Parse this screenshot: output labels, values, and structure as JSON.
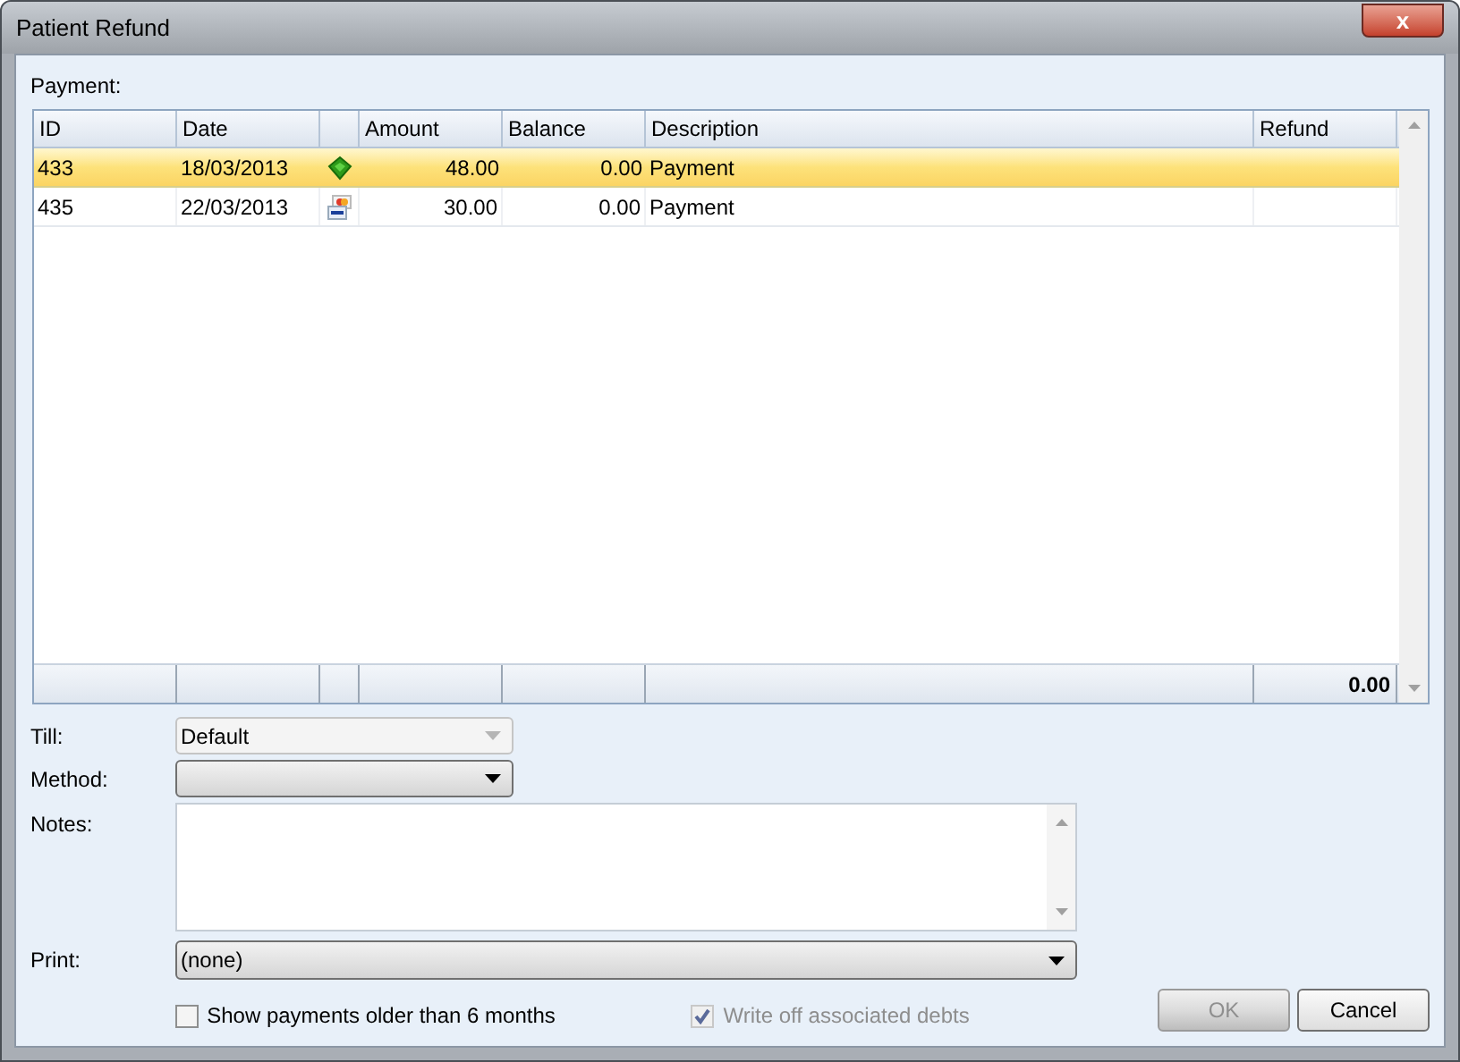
{
  "window": {
    "title": "Patient Refund",
    "close_label": "x"
  },
  "payment": {
    "label": "Payment:",
    "columns": [
      "ID",
      "Date",
      "",
      "Amount",
      "Balance",
      "Description",
      "Refund"
    ],
    "rows": [
      {
        "id": "433",
        "date": "18/03/2013",
        "kind": "cash",
        "amount": "48.00",
        "balance": "0.00",
        "description": "Payment",
        "selected": true
      },
      {
        "id": "435",
        "date": "22/03/2013",
        "kind": "card",
        "amount": "30.00",
        "balance": "0.00",
        "description": "Payment",
        "selected": false
      }
    ],
    "refund_total": "0.00"
  },
  "till": {
    "label": "Till:",
    "value": "Default",
    "disabled": true
  },
  "method": {
    "label": "Method:",
    "disabled": false
  },
  "notes": {
    "label": "Notes:"
  },
  "print": {
    "label": "Print:",
    "value": "(none)",
    "disabled": false
  },
  "options": [
    {
      "label": "Show payments older than 6 months",
      "checked": false,
      "disabled": false
    },
    {
      "label": "Write off associated debts",
      "checked": true,
      "disabled": true
    }
  ],
  "buttons": [
    {
      "label": "OK",
      "disabled": true
    },
    {
      "label": "Cancel",
      "disabled": false
    }
  ]
}
